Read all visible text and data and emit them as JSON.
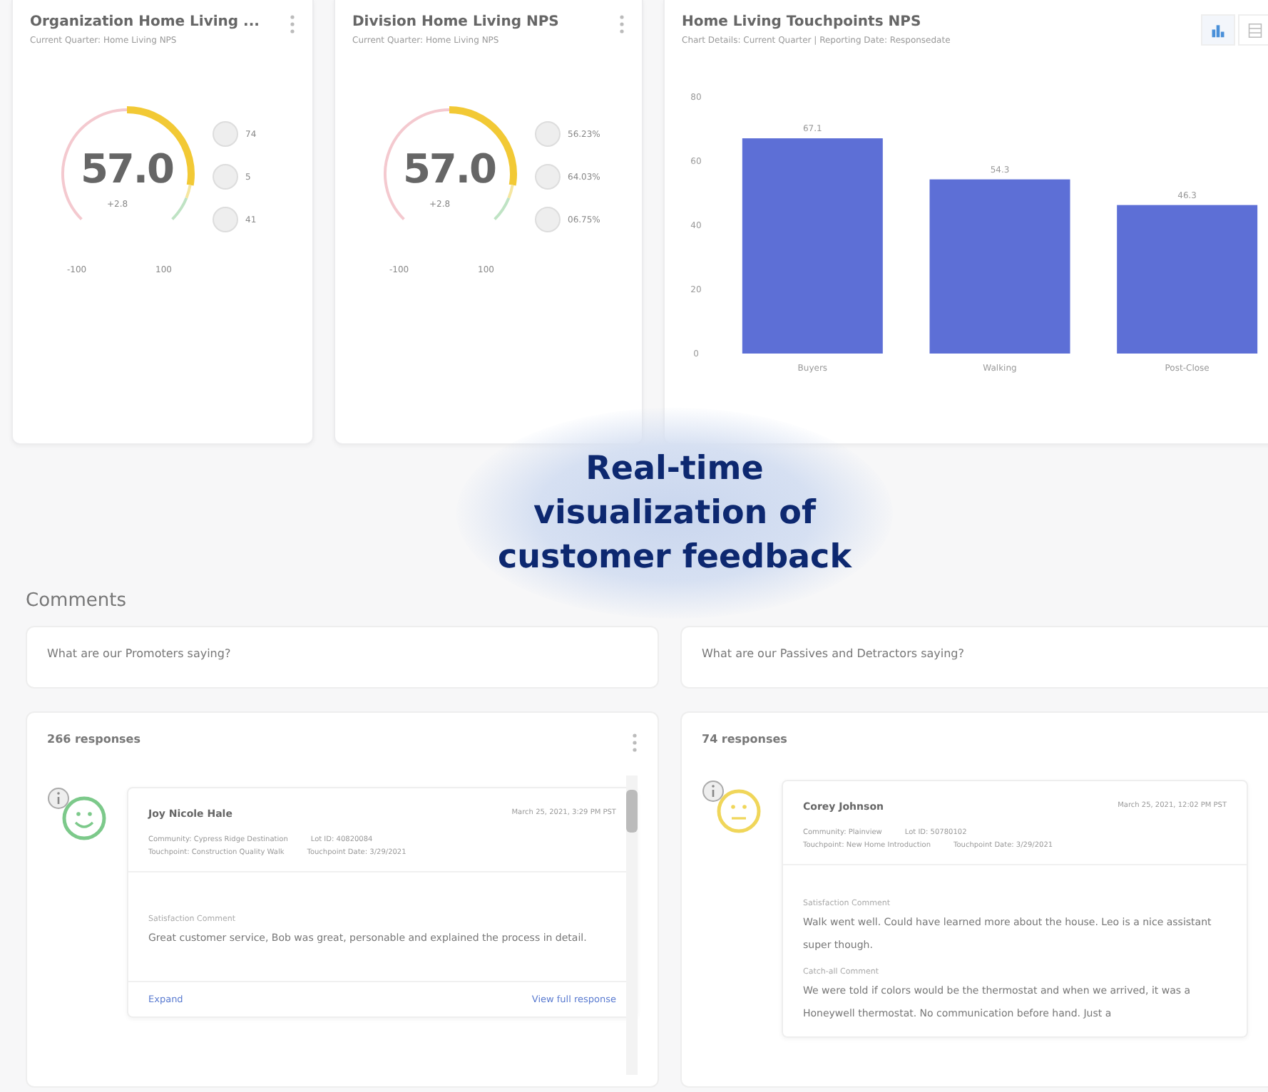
{
  "gauge_cards": [
    {
      "title": "Organization Home Living ...",
      "subtitle": "Current Quarter: Home Living NPS",
      "score": "57.0",
      "delta": "+2.8",
      "min_label": "-100",
      "max_label": "100",
      "legend": [
        "74",
        "5",
        "41"
      ]
    },
    {
      "title": "Division Home Living NPS",
      "subtitle": "Current Quarter: Home Living NPS",
      "score": "57.0",
      "delta": "+2.8",
      "min_label": "-100",
      "max_label": "100",
      "legend": [
        "56.23%",
        "64.03%",
        "06.75%"
      ]
    }
  ],
  "chart_card": {
    "title": "Home Living Touchpoints NPS",
    "subtitle": "Chart Details: Current Quarter | Reporting Date: Responsedate",
    "view_toggle": [
      {
        "kind": "chart",
        "selected": true
      },
      {
        "kind": "table",
        "selected": false
      }
    ],
    "chart_data": {
      "type": "bar",
      "categories": [
        "Buyers",
        "Walking",
        "Post-Close"
      ],
      "values": [
        67.1,
        54.3,
        46.3
      ],
      "ylim": [
        0,
        80
      ],
      "yticks": [
        0,
        20,
        40,
        60,
        80
      ],
      "data_labels": true
    }
  },
  "callout": {
    "text": "Real-time visualization of customer feedback"
  },
  "comments": {
    "title": "Comments",
    "panels": [
      {
        "question": "What are our Promoters saying?",
        "count": "266 responses",
        "kind": "promoter",
        "has_menu": true,
        "has_scrollbar": true,
        "response": {
          "name": "Joy Nicole Hale",
          "date": "March 25, 2021, 3:29 PM PST",
          "meta": [
            [
              "Community: Cypress Ridge Destination",
              "Lot ID: 40820084"
            ],
            [
              "Touchpoint: Construction Quality Walk",
              "Touchpoint Date: 3/29/2021"
            ]
          ],
          "sections": [
            {
              "label": "Satisfaction Comment",
              "text": "Great customer service, Bob was great, personable and explained the process in detail."
            }
          ],
          "expand": "Expand",
          "view_link": "View full response"
        }
      },
      {
        "question": "What are our Passives and Detractors saying?",
        "count": "74 responses",
        "kind": "passive",
        "has_menu": false,
        "has_scrollbar": false,
        "response": {
          "name": "Corey Johnson",
          "date": "March 25, 2021, 12:02 PM PST",
          "meta": [
            [
              "Community: Plainview",
              "Lot ID: 50780102"
            ],
            [
              "Touchpoint: New Home Introduction",
              "Touchpoint Date: 3/29/2021"
            ]
          ],
          "sections": [
            {
              "label": "Satisfaction Comment",
              "text": "Walk went well. Could have learned more about the house. Leo is a nice assistant super though."
            },
            {
              "label": "Catch-all Comment",
              "text": "We were told if colors would be the thermostat and when we arrived, it was a Honeywell thermostat. No communication before hand. Just a"
            }
          ]
        }
      }
    ]
  }
}
